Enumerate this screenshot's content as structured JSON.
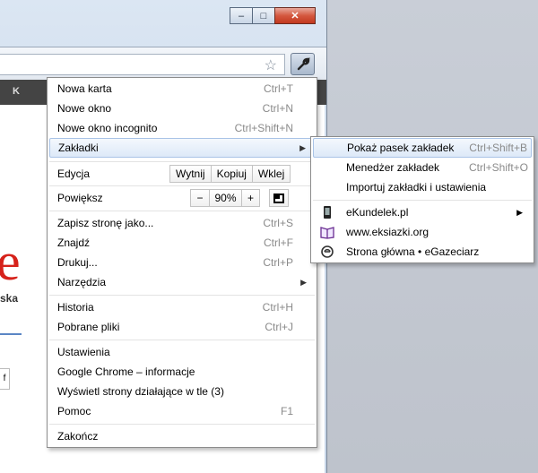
{
  "window": {
    "controls": {
      "minimize": "–",
      "maximize": "□",
      "close": "✕"
    },
    "bookmarks_strip_text": "K",
    "page": {
      "letter": "e",
      "text": "ska",
      "button": "f"
    }
  },
  "main_menu": {
    "items": [
      {
        "label": "Nowa karta",
        "shortcut": "Ctrl+T"
      },
      {
        "label": "Nowe okno",
        "shortcut": "Ctrl+N"
      },
      {
        "label": "Nowe okno incognito",
        "shortcut": "Ctrl+Shift+N"
      },
      {
        "label": "Zakładki",
        "arrow": "▶"
      }
    ],
    "edit": {
      "label": "Edycja",
      "cut": "Wytnij",
      "copy": "Kopiuj",
      "paste": "Wklej"
    },
    "zoom": {
      "label": "Powiększ",
      "minus": "−",
      "value": "90%",
      "plus": "+"
    },
    "group2": [
      {
        "label": "Zapisz stronę jako...",
        "shortcut": "Ctrl+S"
      },
      {
        "label": "Znajdź",
        "shortcut": "Ctrl+F"
      },
      {
        "label": "Drukuj...",
        "shortcut": "Ctrl+P"
      },
      {
        "label": "Narzędzia",
        "arrow": "▶"
      }
    ],
    "group3": [
      {
        "label": "Historia",
        "shortcut": "Ctrl+H"
      },
      {
        "label": "Pobrane pliki",
        "shortcut": "Ctrl+J"
      }
    ],
    "group4": [
      {
        "label": "Ustawienia"
      },
      {
        "label": "Google Chrome – informacje"
      },
      {
        "label": "Wyświetl strony działające w tle (3)"
      },
      {
        "label": "Pomoc",
        "shortcut": "F1"
      }
    ],
    "exit": {
      "label": "Zakończ"
    }
  },
  "bookmarks_submenu": {
    "items": [
      {
        "label": "Pokaż pasek zakładek",
        "shortcut": "Ctrl+Shift+B"
      },
      {
        "label": "Menedżer zakładek",
        "shortcut": "Ctrl+Shift+O"
      },
      {
        "label": "Importuj zakładki i ustawienia"
      }
    ],
    "bookmarks": [
      {
        "label": "eKundelek.pl",
        "arrow": "▶",
        "icon": "device-icon"
      },
      {
        "label": "www.eksiazki.org",
        "icon": "book-icon"
      },
      {
        "label": "Strona główna • eGazeciarz",
        "icon": "egazeciarz-icon"
      }
    ]
  },
  "colors": {
    "highlight": "#dde9f8",
    "highlight_border": "#a9c3e6",
    "accent_red": "#d6221b"
  }
}
